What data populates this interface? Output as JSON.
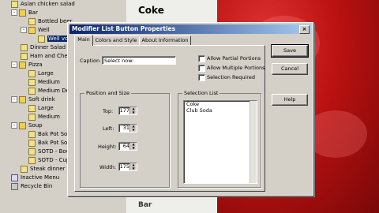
{
  "tree": {
    "items": [
      {
        "label": "Asian chicken salad",
        "icon": "document-icon"
      },
      {
        "label": "Bar",
        "icon": "folder-icon",
        "expander": "-"
      },
      {
        "label": "Bottled beer",
        "icon": "document-icon"
      },
      {
        "label": "Well",
        "icon": "folder-icon",
        "expander": "-"
      },
      {
        "label": "Well vodka",
        "icon": "document-icon",
        "selected": true
      },
      {
        "label": "Dinner Salad",
        "icon": "document-icon"
      },
      {
        "label": "Ham and Cheese",
        "icon": "document-icon"
      },
      {
        "label": "Pizza",
        "icon": "folder-icon",
        "expander": "-"
      },
      {
        "label": "Large",
        "icon": "document-icon"
      },
      {
        "label": "Medium",
        "icon": "document-icon"
      },
      {
        "label": "Medium Deluxe",
        "icon": "document-icon"
      },
      {
        "label": "Soft drink",
        "icon": "folder-icon",
        "expander": "-"
      },
      {
        "label": "Large",
        "icon": "document-icon"
      },
      {
        "label": "Medium",
        "icon": "document-icon"
      },
      {
        "label": "Soup",
        "icon": "folder-icon",
        "expander": "-"
      },
      {
        "label": "Bak Pot Soup",
        "icon": "document-icon"
      },
      {
        "label": "Bak Pot Soup",
        "icon": "document-icon"
      },
      {
        "label": "SOTD - Bowl",
        "icon": "document-icon"
      },
      {
        "label": "SOTD - Cup",
        "icon": "document-icon"
      },
      {
        "label": "Steak dinner",
        "icon": "document-icon"
      },
      {
        "label": "Inactive Menu",
        "icon": "menu-icon"
      },
      {
        "label": "Recycle Bin",
        "icon": "recycle-bin-icon"
      }
    ]
  },
  "preview": {
    "title": "Coke",
    "footer": "Bar"
  },
  "dialog": {
    "title": "Modifier List Button Properties",
    "close_glyph": "×",
    "tabs": [
      "Main",
      "Colors and Style",
      "About Information"
    ],
    "active_tab": "Main",
    "caption_label": "Caption",
    "caption_value": "Select now:",
    "checkboxes": [
      {
        "label": "Allow Partial Portions",
        "checked": false
      },
      {
        "label": "Allow Multiple Portions",
        "checked": false
      },
      {
        "label": "Selection Required",
        "checked": false
      }
    ],
    "position_group_title": "Position and Size",
    "position_fields": [
      {
        "label": "Top:",
        "value": "177"
      },
      {
        "label": "Left:",
        "value": "31"
      },
      {
        "label": "Height:",
        "value": "64"
      },
      {
        "label": "Width:",
        "value": "175"
      }
    ],
    "selection_group_title": "Selection List",
    "selection_items": [
      "Coke",
      "Club Soda"
    ],
    "buttons": {
      "save": "Save",
      "cancel": "Cancel",
      "help": "Help"
    }
  },
  "colors": {
    "titlebar_start": "#0a246a",
    "titlebar_end": "#a6caf0",
    "dialog_face": "#d4d0c8",
    "red_panel": "#b11111"
  }
}
